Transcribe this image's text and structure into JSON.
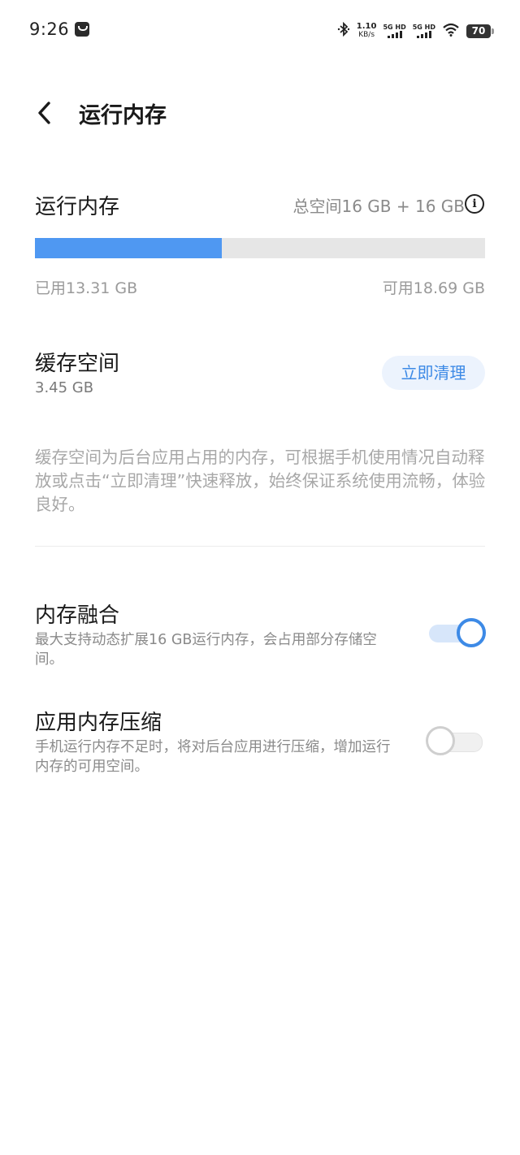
{
  "status_bar": {
    "time": "9:26",
    "net_speed_value": "1.10",
    "net_speed_unit": "KB/s",
    "sim1_label": "5G HD",
    "sim2_label": "5G HD",
    "battery": "70"
  },
  "header": {
    "title": "运行内存"
  },
  "memory": {
    "title": "运行内存",
    "total": "总空间16 GB + 16 GB",
    "used": "已用13.31 GB",
    "available": "可用18.69 GB",
    "used_fraction": 0.416,
    "bar_color": "#4f98f2"
  },
  "cache": {
    "title": "缓存空间",
    "size": "3.45 GB",
    "clean_label": "立即清理",
    "description": "缓存空间为后台应用占用的内存，可根据手机使用情况自动释放或点击“立即清理”快速释放，始终保证系统使用流畅，体验良好。"
  },
  "settings": [
    {
      "title": "内存融合",
      "subtitle": "最大支持动态扩展16 GB运行内存，会占用部分存储空间。",
      "enabled": true
    },
    {
      "title": "应用内存压缩",
      "subtitle": "手机运行内存不足时，将对后台应用进行压缩，增加运行内存的可用空间。",
      "enabled": false
    }
  ],
  "colors": {
    "accent": "#3d8ae6",
    "progress": "#4f98f2"
  },
  "icons": {
    "back": "chevron-left",
    "info": "info-circle",
    "bluetooth": "bluetooth",
    "wifi": "wifi",
    "message": "message-badge"
  }
}
